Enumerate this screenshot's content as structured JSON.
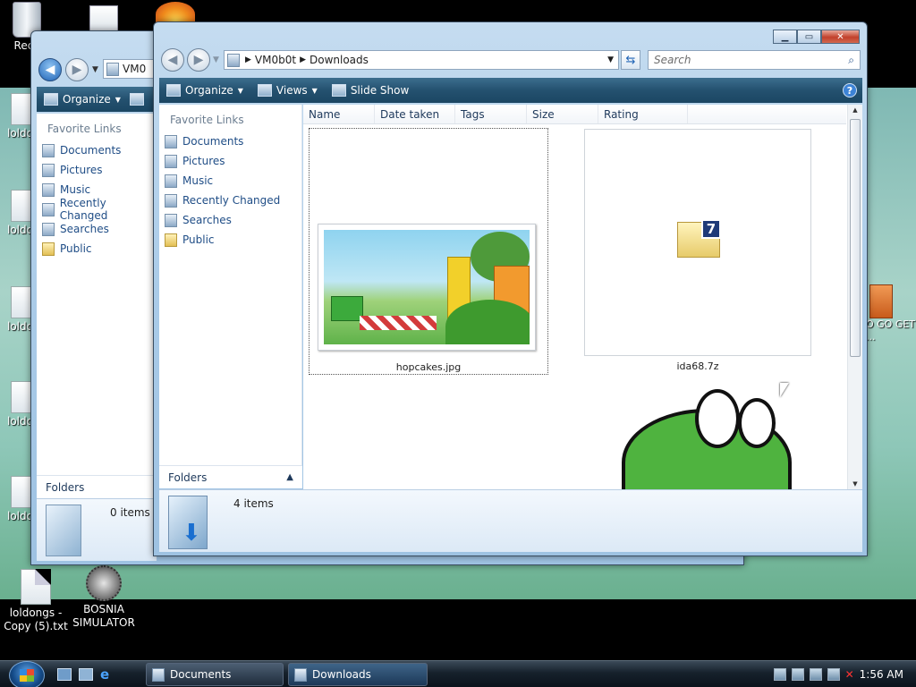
{
  "desktop": {
    "icons": [
      {
        "name": "Recy",
        "kind": "recycle-bin"
      },
      {
        "name": "loldongs - Copy (5).txt",
        "kind": "text-file"
      },
      {
        "name": "BOSNIA SIMULATOR",
        "kind": "app"
      }
    ],
    "left_icons": [
      "loldo",
      "loldo Co",
      "loldo Copy",
      "loldo Copy",
      "loldo Copy"
    ],
    "right_icon_text": "O GO GET ..."
  },
  "back_window": {
    "address": "VM0",
    "toolbar": {
      "organize": "Organize"
    },
    "nav": {
      "header": "Favorite Links",
      "items": [
        "Documents",
        "Pictures",
        "Music",
        "Recently Changed",
        "Searches",
        "Public"
      ]
    },
    "folders_label": "Folders",
    "details": {
      "count": "0 items"
    }
  },
  "front_window": {
    "address": {
      "root": "VM0b0t",
      "folder": "Downloads"
    },
    "search": {
      "placeholder": "Search"
    },
    "toolbar": {
      "organize": "Organize",
      "views": "Views",
      "slideshow": "Slide Show"
    },
    "nav": {
      "header": "Favorite Links",
      "items": [
        "Documents",
        "Pictures",
        "Music",
        "Recently Changed",
        "Searches",
        "Public"
      ]
    },
    "folders_label": "Folders",
    "columns": [
      "Name",
      "Date taken",
      "Tags",
      "Size",
      "Rating"
    ],
    "files": [
      {
        "name": "hopcakes.jpg",
        "type": "image",
        "selected": true
      },
      {
        "name": "ida68.7z",
        "type": "archive",
        "badge": "7"
      }
    ],
    "details": {
      "count": "4 items"
    }
  },
  "taskbar": {
    "buttons": [
      "Documents",
      "Downloads"
    ],
    "active": "Downloads",
    "clock": "1:56 AM"
  },
  "colors": {
    "toolbar": "#24516f",
    "link": "#1f4d86",
    "accent": "#3d83d6"
  }
}
